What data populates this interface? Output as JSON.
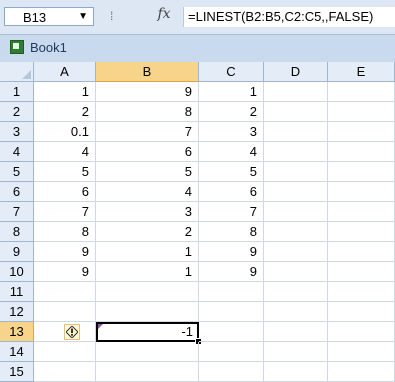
{
  "formula_bar": {
    "name_box": "B13",
    "fx_label": "fx",
    "formula": "=LINEST(B2:B5,C2:C5,,FALSE)"
  },
  "workbook": {
    "title": "Book1"
  },
  "columns": [
    "A",
    "B",
    "C",
    "D",
    "E"
  ],
  "selected_column": "B",
  "selected_row": "13",
  "rows": [
    {
      "n": "1",
      "A": "1",
      "B": "9",
      "C": "1"
    },
    {
      "n": "2",
      "A": "2",
      "B": "8",
      "C": "2"
    },
    {
      "n": "3",
      "A": "0.1",
      "B": "7",
      "C": "3"
    },
    {
      "n": "4",
      "A": "4",
      "B": "6",
      "C": "4"
    },
    {
      "n": "5",
      "A": "5",
      "B": "5",
      "C": "5"
    },
    {
      "n": "6",
      "A": "6",
      "B": "4",
      "C": "6"
    },
    {
      "n": "7",
      "A": "7",
      "B": "3",
      "C": "7"
    },
    {
      "n": "8",
      "A": "8",
      "B": "2",
      "C": "8"
    },
    {
      "n": "9",
      "A": "9",
      "B": "1",
      "C": "9"
    },
    {
      "n": "10",
      "A": "9",
      "B": "1",
      "C": "9"
    },
    {
      "n": "11",
      "A": "",
      "B": "",
      "C": ""
    },
    {
      "n": "12",
      "A": "",
      "B": "",
      "C": ""
    },
    {
      "n": "13",
      "A": "",
      "B": "-1",
      "C": ""
    },
    {
      "n": "14",
      "A": "",
      "B": "",
      "C": ""
    },
    {
      "n": "15",
      "A": "",
      "B": "",
      "C": ""
    }
  ],
  "icons": {
    "error_smart_tag": "warning-diamond-icon",
    "name_box_dropdown": "chevron-down-icon",
    "workbook": "excel-workbook-icon"
  },
  "colors": {
    "selected_header": "#f8d48a",
    "header_bg": "#e4ecf7",
    "gridline": "#d0d7e5",
    "formula_bar_bg": "#dde6f3"
  }
}
